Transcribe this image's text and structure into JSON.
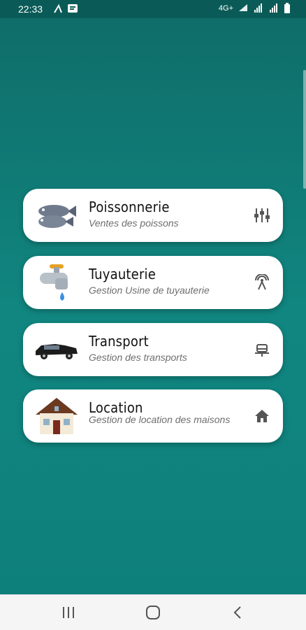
{
  "status_bar": {
    "time": "22:33",
    "left_icons": [
      "signal-icon",
      "message-icon"
    ],
    "right_icons": [
      "wifi-icon",
      "cell-signal-1-icon",
      "cell-signal-2-icon",
      "battery-icon"
    ],
    "data_small": "4G+"
  },
  "cards": [
    {
      "title": "Poissonnerie",
      "subtitle": "Ventes des poissons",
      "thumb": "fish-icon",
      "icon": "equalizer-icon"
    },
    {
      "title": "Tuyauterie",
      "subtitle": "Gestion Usine de tuyauterie",
      "thumb": "faucet-icon",
      "icon": "antenna-icon"
    },
    {
      "title": "Transport",
      "subtitle": "Gestion des transports",
      "thumb": "car-icon",
      "icon": "road-car-icon"
    },
    {
      "title": "Location",
      "subtitle": "Gestion de location des maisons",
      "thumb": "house-icon",
      "icon": "home-icon"
    }
  ],
  "nav_bar": [
    "recent-apps-icon",
    "home-circle-icon",
    "back-icon"
  ],
  "colors": {
    "background": "#0e7f7b",
    "card": "#ffffff",
    "title": "#111111",
    "subtitle": "#6e6e6e"
  }
}
